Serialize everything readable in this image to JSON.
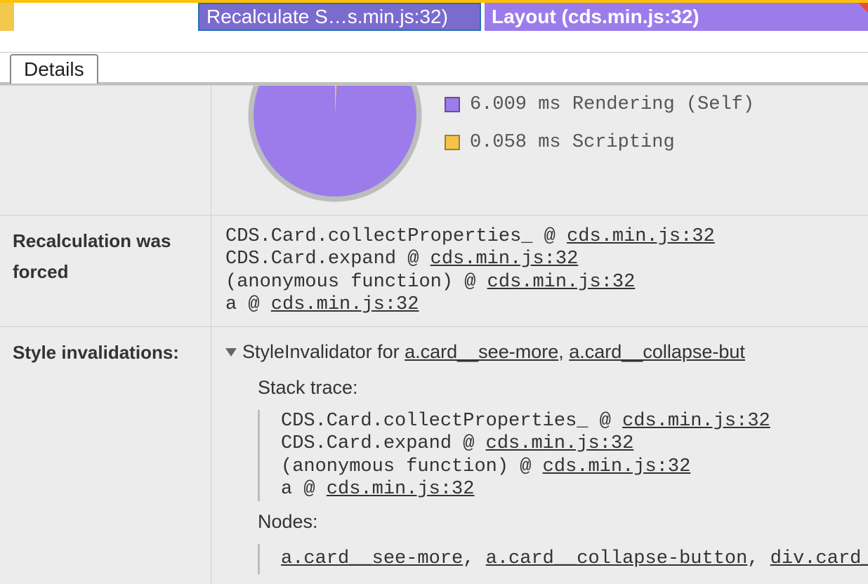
{
  "timeline": {
    "recalc_label": "Recalculate S…s.min.js:32)",
    "layout_label": "Layout (cds.min.js:32)"
  },
  "tabs": {
    "details": "Details"
  },
  "chart_data": {
    "type": "pie",
    "series": [
      {
        "name": "Rendering (Self)",
        "value": 6.009,
        "unit": "ms",
        "color": "#9c7cea"
      },
      {
        "name": "Scripting",
        "value": 0.058,
        "unit": "ms",
        "color": "#f5c24b"
      }
    ]
  },
  "legend": {
    "rendering": "6.009 ms Rendering (Self)",
    "scripting": "0.058 ms Scripting"
  },
  "rows": {
    "recalc_forced_label": "Recalculation was forced",
    "style_inval_label": "Style invalidations:"
  },
  "stack1": {
    "l0_fn": "CDS.Card.collectProperties_ @ ",
    "l0_link": "cds.min.js:32",
    "l1_fn": "CDS.Card.expand @ ",
    "l1_link": "cds.min.js:32",
    "l2_fn": "(anonymous function) @ ",
    "l2_link": "cds.min.js:32",
    "l3_fn": "a @ ",
    "l3_link": "cds.min.js:32"
  },
  "invalidator": {
    "prefix": "StyleInvalidator for ",
    "sel1": "a.card__see-more",
    "comma": ", ",
    "sel2": "a.card__collapse-but",
    "stack_trace_label": "Stack trace:",
    "nodes_label": "Nodes:",
    "nodes_sel1": "a.card__see-more",
    "nodes_sel2": "a.card__collapse-button",
    "nodes_sel3": "div.card_"
  }
}
